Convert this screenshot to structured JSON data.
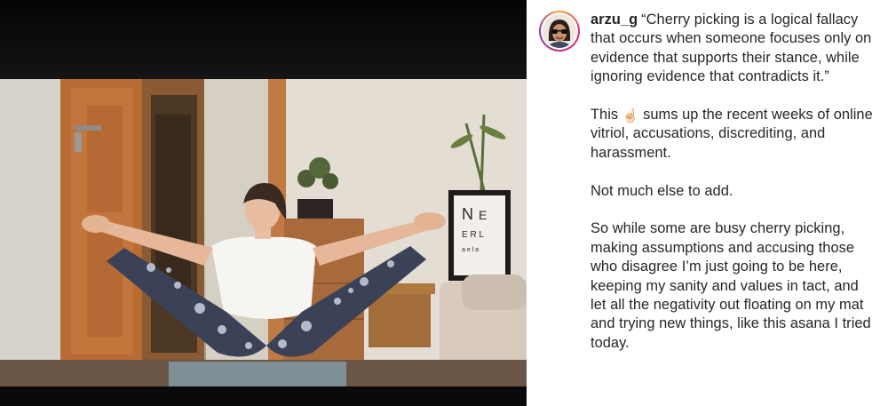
{
  "post": {
    "author": {
      "username": "arzu_g",
      "avatar_icon": "profile-photo"
    },
    "caption": {
      "quote": "“Cherry picking is a logical fallacy that occurs when someone focuses only on evidence that supports their stance, while ignoring evidence that contradicts it.”",
      "p2_pre": "This ",
      "p2_emoji": "☝🏻",
      "p2_post": " sums up the recent weeks of online vitriol, accusations, discrediting, and harassment.",
      "p3": "Not much else to add.",
      "p4": "So while some are busy cherry picking, making assumptions and accusing those who disagree I’m just going to be here, keeping my sanity and values in tact, and let all the negativity out floating on my mat and trying new things, like this asana I tried today."
    },
    "media": {
      "type": "photo",
      "description_icon": "yoga-photo"
    }
  },
  "colors": {
    "text": "#262626",
    "background": "#ffffff",
    "media_background": "#0c0c0c",
    "avatar_ring": "#e1306c"
  }
}
